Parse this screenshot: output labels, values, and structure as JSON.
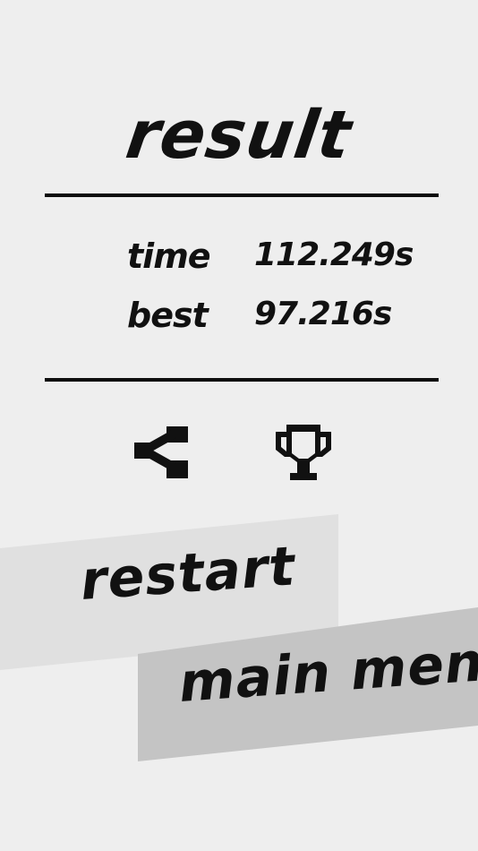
{
  "screen": {
    "title": "result"
  },
  "stats": {
    "time_label": "time",
    "time_value": "112.249s",
    "best_label": "best",
    "best_value": "97.216s"
  },
  "icons": {
    "share": "share-icon",
    "trophy": "trophy-icon"
  },
  "buttons": {
    "restart_label": "restart",
    "main_menu_label": "main menu"
  },
  "colors": {
    "background": "#eeeeee",
    "text": "#111111",
    "restart_panel": "#e0e0e0",
    "main_menu_panel": "#c4c4c4",
    "divider": "#0d0d0d"
  }
}
